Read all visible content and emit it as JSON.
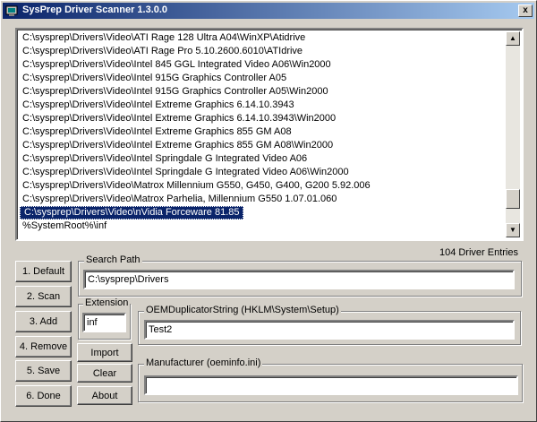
{
  "window": {
    "title": "SysPrep Driver Scanner 1.3.0.0",
    "close_label": "x"
  },
  "driver_list": {
    "items": [
      "C:\\sysprep\\Drivers\\Video\\ATI Rage 128 Ultra A04\\WinXP\\Atidrive",
      "C:\\sysprep\\Drivers\\Video\\ATI Rage Pro 5.10.2600.6010\\ATIdrive",
      "C:\\sysprep\\Drivers\\Video\\Intel 845 GGL Integrated Video A06\\Win2000",
      "C:\\sysprep\\Drivers\\Video\\Intel 915G Graphics Controller A05",
      "C:\\sysprep\\Drivers\\Video\\Intel 915G Graphics Controller A05\\Win2000",
      "C:\\sysprep\\Drivers\\Video\\Intel Extreme Graphics 6.14.10.3943",
      "C:\\sysprep\\Drivers\\Video\\Intel Extreme Graphics 6.14.10.3943\\Win2000",
      "C:\\sysprep\\Drivers\\Video\\Intel Extreme Graphics 855 GM A08",
      "C:\\sysprep\\Drivers\\Video\\Intel Extreme Graphics 855 GM A08\\Win2000",
      "C:\\sysprep\\Drivers\\Video\\Intel Springdale G Integrated Video A06",
      "C:\\sysprep\\Drivers\\Video\\Intel Springdale G Integrated Video A06\\Win2000",
      "C:\\sysprep\\Drivers\\Video\\Matrox Millennium G550, G450, G400, G200 5.92.006",
      "C:\\sysprep\\Drivers\\Video\\Matrox Parhelia, Millennium G550 1.07.01.060",
      "C:\\sysprep\\Drivers\\Video\\nVidia Forceware 81.85",
      "%SystemRoot%\\inf"
    ],
    "selected_index": 13,
    "scroll_up": "▲",
    "scroll_down": "▼"
  },
  "entries_text": "104  Driver Entries",
  "buttons": {
    "default": "1. Default",
    "scan": "2. Scan",
    "add": "3. Add",
    "remove": "4. Remove",
    "save": "5. Save",
    "done": "6. Done",
    "import": "Import",
    "clear": "Clear",
    "about": "About"
  },
  "search_path": {
    "label": "Search Path",
    "value": "C:\\sysprep\\Drivers"
  },
  "extension": {
    "label": "Extension",
    "value": "inf"
  },
  "oem_string": {
    "label": "OEMDuplicatorString (HKLM\\System\\Setup)",
    "value": "Test2"
  },
  "manufacturer": {
    "label": "Manufacturer (oeminfo.ini)",
    "value": ""
  }
}
